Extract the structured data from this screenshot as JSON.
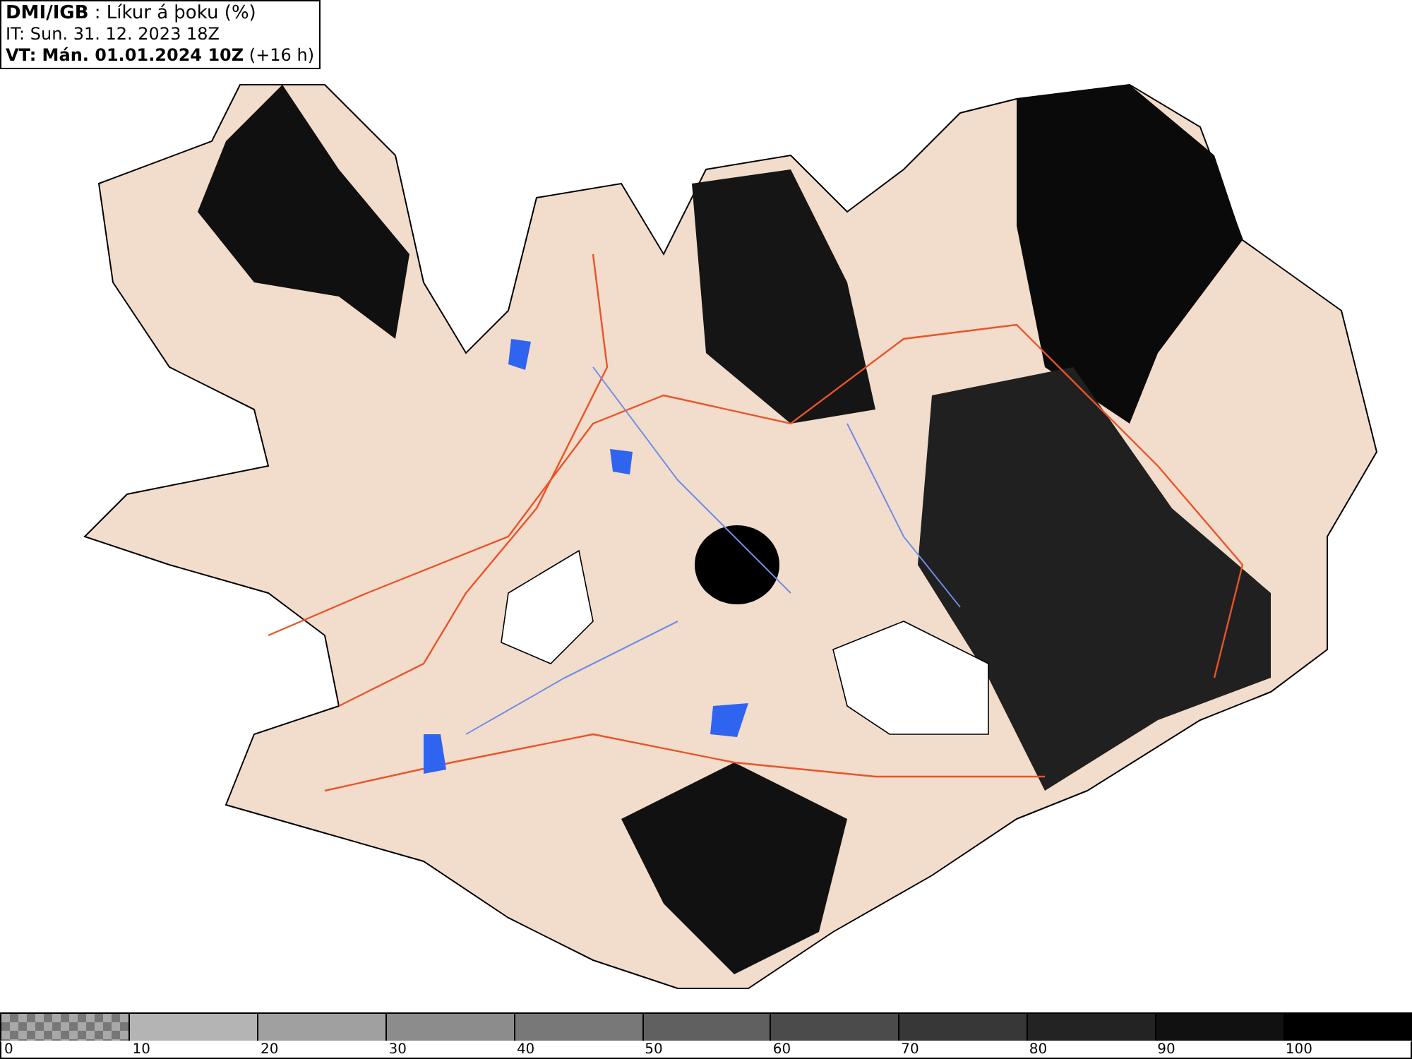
{
  "header": {
    "lines": [
      "**DMI/IGB** : Líkur á þoku (%)",
      "IT: Sun. 31. 12. 2023 18Z",
      "**VT: Mán. 01.01.2024 10Z** (+16 h)"
    ]
  },
  "legend": {
    "bins": [
      {
        "kind": "checker",
        "color": "#777777"
      },
      {
        "kind": "solid",
        "color": "#b4b4b4"
      },
      {
        "kind": "solid",
        "color": "#a0a0a0"
      },
      {
        "kind": "solid",
        "color": "#8c8c8c"
      },
      {
        "kind": "solid",
        "color": "#787878"
      },
      {
        "kind": "solid",
        "color": "#606060"
      },
      {
        "kind": "solid",
        "color": "#4b4b4b"
      },
      {
        "kind": "solid",
        "color": "#373737"
      },
      {
        "kind": "solid",
        "color": "#232323"
      },
      {
        "kind": "solid",
        "color": "#111111"
      },
      {
        "kind": "solid",
        "color": "#000000"
      }
    ],
    "labels": [
      "0",
      "10",
      "20",
      "30",
      "40",
      "50",
      "60",
      "70",
      "80",
      "90",
      "100"
    ]
  }
}
